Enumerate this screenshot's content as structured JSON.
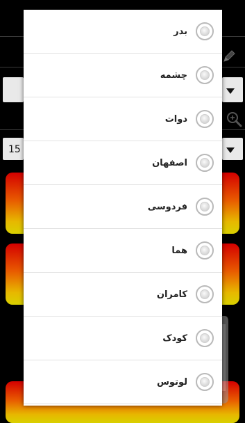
{
  "background": {
    "spinner_value": "15",
    "icons": [
      "pencil-icon",
      "zoom-icon",
      "phone-watermark-icon"
    ],
    "card_colors": [
      "#d40000",
      "#e85a00",
      "#e7b800"
    ]
  },
  "dialog": {
    "options": [
      {
        "label": "بدر",
        "selected": false
      },
      {
        "label": "چشمه",
        "selected": false
      },
      {
        "label": "دوات",
        "selected": false
      },
      {
        "label": "اصفهان",
        "selected": false
      },
      {
        "label": "فردوسی",
        "selected": false
      },
      {
        "label": "هما",
        "selected": false
      },
      {
        "label": "کامران",
        "selected": false
      },
      {
        "label": "کودک",
        "selected": false
      },
      {
        "label": "لوتوس",
        "selected": false
      }
    ]
  }
}
